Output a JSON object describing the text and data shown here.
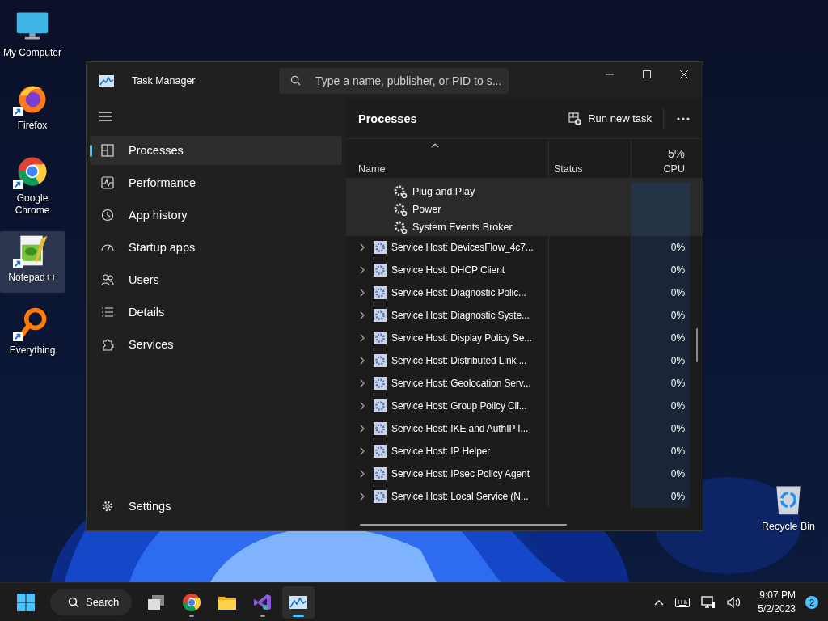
{
  "desktop_icons": [
    {
      "kind": "computer",
      "label": "My Computer",
      "shortcut": false,
      "selected": false
    },
    {
      "kind": "firefox",
      "label": "Firefox",
      "shortcut": true,
      "selected": false
    },
    {
      "kind": "chrome",
      "label": "Google Chrome",
      "shortcut": true,
      "selected": false
    },
    {
      "kind": "notepad",
      "label": "Notepad++",
      "shortcut": true,
      "selected": true
    },
    {
      "kind": "everything",
      "label": "Everything",
      "shortcut": true,
      "selected": false
    }
  ],
  "recycle_bin": {
    "label": "Recycle Bin"
  },
  "window": {
    "title": "Task Manager",
    "search": {
      "placeholder": "Type a name, publisher, or PID to s..."
    },
    "nav": [
      {
        "kind": "processes",
        "label": "Processes",
        "selected": true
      },
      {
        "kind": "performance",
        "label": "Performance",
        "selected": false
      },
      {
        "kind": "history",
        "label": "App history",
        "selected": false
      },
      {
        "kind": "startup",
        "label": "Startup apps",
        "selected": false
      },
      {
        "kind": "users",
        "label": "Users",
        "selected": false
      },
      {
        "kind": "details",
        "label": "Details",
        "selected": false
      },
      {
        "kind": "services",
        "label": "Services",
        "selected": false
      }
    ],
    "settings": "Settings",
    "page_title": "Processes",
    "run_new_task": "Run new task",
    "columns": {
      "name": "Name",
      "status": "Status",
      "cpu_total": "5%",
      "cpu": "CPU"
    },
    "child_services": [
      "Plug and Play",
      "Power",
      "System Events Broker"
    ],
    "rows": [
      {
        "name": "Service Host: DevicesFlow_4c7...",
        "cpu": "0%",
        "expanded": false
      },
      {
        "name": "Service Host: DHCP Client",
        "cpu": "0%",
        "expanded": false
      },
      {
        "name": "Service Host: Diagnostic Polic...",
        "cpu": "0%",
        "expanded": false
      },
      {
        "name": "Service Host: Diagnostic Syste...",
        "cpu": "0%",
        "expanded": false
      },
      {
        "name": "Service Host: Display Policy Se...",
        "cpu": "0%",
        "expanded": false
      },
      {
        "name": "Service Host: Distributed Link ...",
        "cpu": "0%",
        "expanded": false
      },
      {
        "name": "Service Host: Geolocation Serv...",
        "cpu": "0%",
        "expanded": false
      },
      {
        "name": "Service Host: Group Policy Cli...",
        "cpu": "0%",
        "expanded": false
      },
      {
        "name": "Service Host: IKE and AuthIP I...",
        "cpu": "0%",
        "expanded": false
      },
      {
        "name": "Service Host: IP Helper",
        "cpu": "0%",
        "expanded": false
      },
      {
        "name": "Service Host: IPsec Policy Agent",
        "cpu": "0%",
        "expanded": false
      },
      {
        "name": "Service Host: Local Service (N...",
        "cpu": "0%",
        "expanded": false
      }
    ]
  },
  "taskbar": {
    "search": "Search",
    "apps": [
      {
        "kind": "taskview",
        "running": false,
        "selected": false
      },
      {
        "kind": "chrome",
        "running": true,
        "selected": false
      },
      {
        "kind": "folder",
        "running": false,
        "selected": false
      },
      {
        "kind": "vs",
        "running": true,
        "selected": false
      },
      {
        "kind": "taskmgr",
        "running": true,
        "selected": true
      }
    ],
    "time": "9:07 PM",
    "date": "5/2/2023",
    "notifications": "2"
  }
}
